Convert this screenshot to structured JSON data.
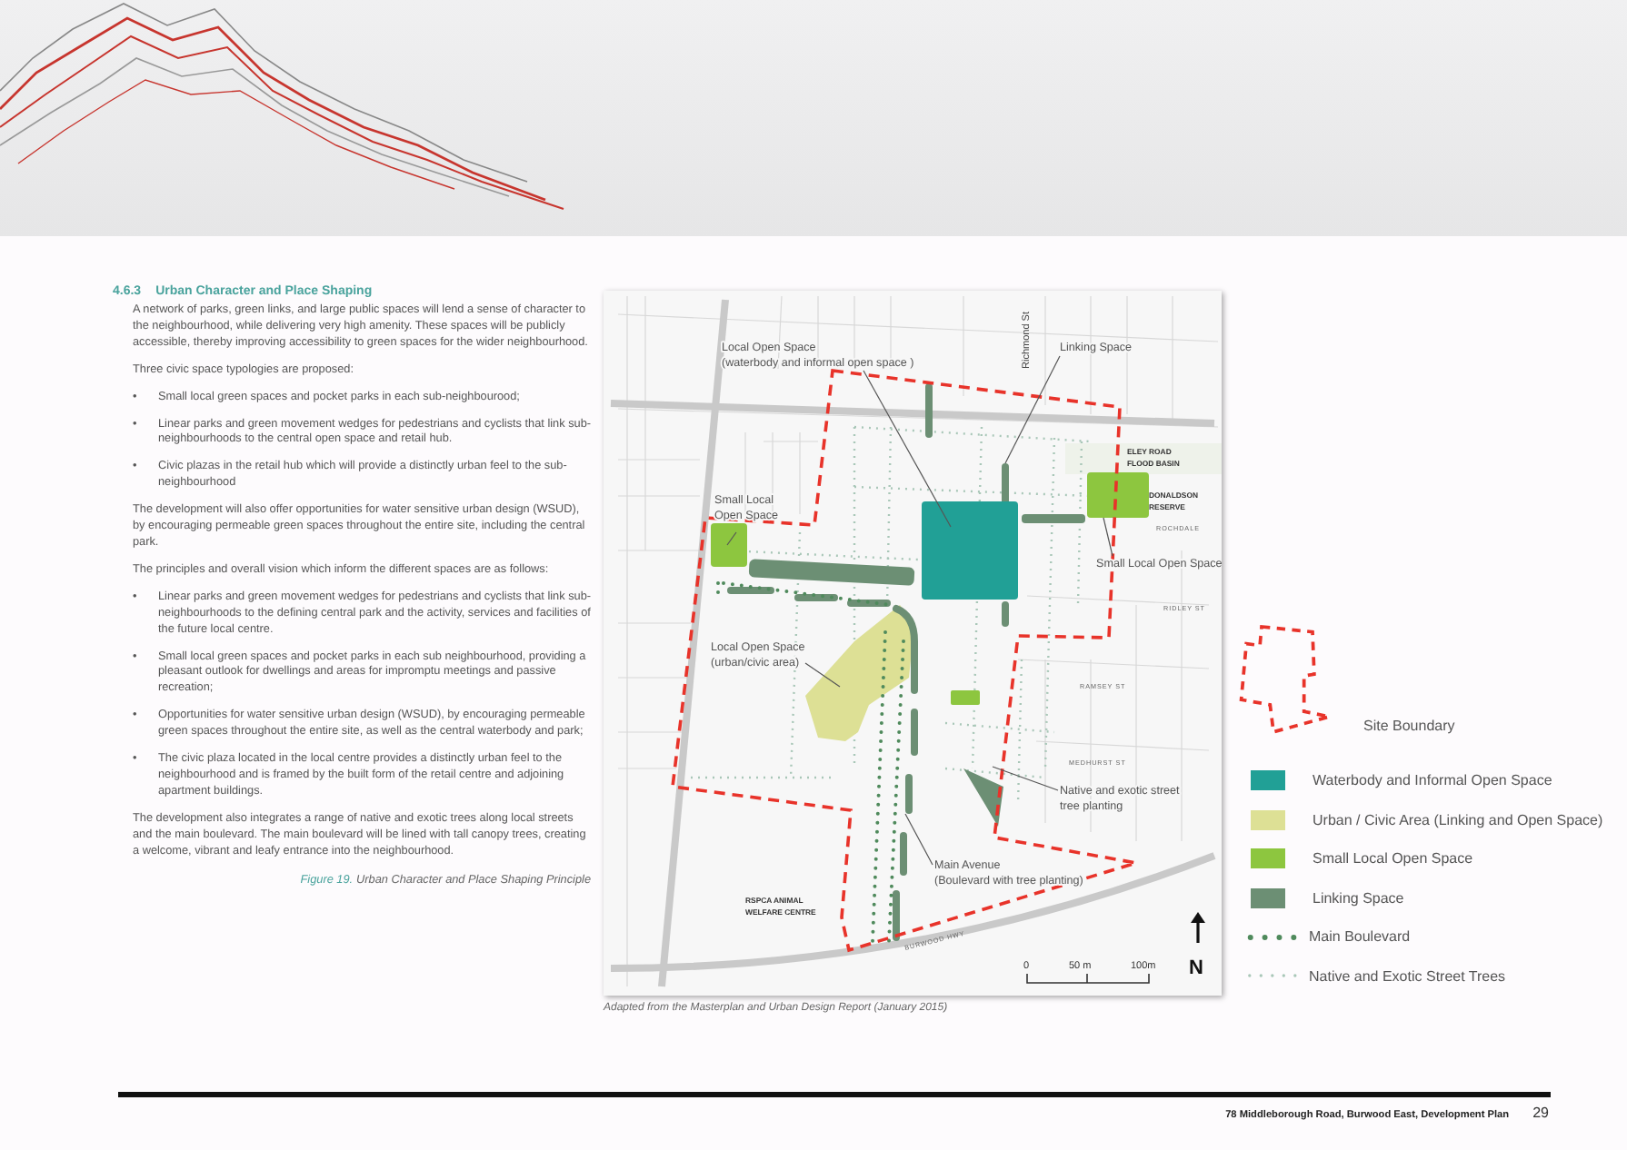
{
  "section": {
    "number": "4.6.3",
    "title": "Urban Character and Place Shaping"
  },
  "body": [
    {
      "kind": "paragraph",
      "text": "A network of parks, green links, and large public spaces will lend a sense of character to the neighbourhood, while delivering very high amenity. These spaces will be publicly accessible, thereby improving accessibility to green spaces for the wider neighbourhood."
    },
    {
      "kind": "paragraph",
      "text": "Three civic space typologies are proposed:"
    },
    {
      "kind": "bullet",
      "marker": "•",
      "text": "Small local green spaces and pocket parks in each sub-neighbourood;"
    },
    {
      "kind": "bullet",
      "marker": "•",
      "text": "Linear parks and green movement wedges for pedestrians and cyclists that link sub-neighbourhoods to the central open space and retail hub."
    },
    {
      "kind": "bullet",
      "marker": "•",
      "text": "Civic plazas in the retail hub which will provide a distinctly urban feel to the sub-neighbourhood"
    },
    {
      "kind": "paragraph",
      "text": "The development will also offer opportunities for water sensitive urban design (WSUD), by encouraging permeable green spaces throughout the entire site, including the central park."
    },
    {
      "kind": "paragraph",
      "text": "The principles and overall vision which inform the different spaces are as follows:"
    },
    {
      "kind": "bullet",
      "marker": "•",
      "text": "Linear parks and green movement wedges for pedestrians and cyclists that link sub-neighbourhoods to the defining central park and the activity, services and facilities of the future local centre."
    },
    {
      "kind": "bullet",
      "marker": "•",
      "text": "Small local green spaces and pocket parks in each sub neighbourhood, providing a pleasant outlook for dwellings and areas for impromptu meetings and passive recreation;"
    },
    {
      "kind": "bullet",
      "marker": "•",
      "text": "Opportunities for water sensitive urban design (WSUD), by encouraging permeable green spaces throughout the entire site, as well as the central waterbody and park;"
    },
    {
      "kind": "bullet",
      "marker": "•",
      "text": "The civic plaza located in the local centre provides a distinctly urban feel to the neighbourhood and is framed by the built form of the retail centre and adjoining apartment buildings."
    },
    {
      "kind": "paragraph",
      "text": "The development also integrates a range of native and exotic trees along local streets and the main boulevard. The main boulevard will be lined with tall canopy trees, creating a welcome, vibrant and leafy entrance into the neighbourhood."
    }
  ],
  "figure_caption": {
    "label": "Figure 19.",
    "text": "Urban Character and Place Shaping Principle"
  },
  "map": {
    "callouts": [
      {
        "lines": [
          "Local Open Space",
          "(waterbody and informal open space )"
        ]
      },
      {
        "lines": [
          "Linking Space"
        ]
      },
      {
        "lines": [
          "Small Local",
          "Open Space"
        ]
      },
      {
        "lines": [
          "Small Local Open Space"
        ]
      },
      {
        "lines": [
          "Local Open Space",
          "(urban/civic area)"
        ]
      },
      {
        "lines": [
          "Native and exotic street",
          "tree planting"
        ]
      },
      {
        "lines": [
          "Main Avenue",
          "(Boulevard with tree planting)"
        ]
      }
    ],
    "places": [
      {
        "lines": [
          "ELEY ROAD",
          "FLOOD BASIN"
        ]
      },
      {
        "lines": [
          "DONALDSON",
          "RESERVE"
        ]
      },
      {
        "lines": [
          "RSPCA ANIMAL",
          "WELFARE CENTRE"
        ]
      }
    ],
    "streets": [
      "Richmond St",
      "RIDLEY ST",
      "RAMSEY ST",
      "MEDHURST ST",
      "ROCHDALE",
      "BURWOOD HWY"
    ],
    "scale": [
      "0",
      "50 m",
      "100m"
    ],
    "north": "N",
    "source": "Adapted from the Masterplan and Urban Design Report (January 2015)"
  },
  "legend": [
    {
      "kind": "boundary",
      "label": "Site Boundary",
      "color": "#e8332a"
    },
    {
      "kind": "swatch",
      "label": "Waterbody and Informal Open Space",
      "color": "#21a096"
    },
    {
      "kind": "swatch",
      "label": "Urban / Civic Area (Linking and Open Space)",
      "color": "#dde095"
    },
    {
      "kind": "swatch",
      "label": "Small Local Open Space",
      "color": "#8dc63f"
    },
    {
      "kind": "swatch",
      "label": "Linking Space",
      "color": "#6c8f74"
    },
    {
      "kind": "dots",
      "label": "Main Boulevard",
      "color": "#4f8a5c"
    },
    {
      "kind": "smalldots",
      "label": "Native and Exotic Street Trees",
      "color": "#a9c7b8"
    }
  ],
  "footer": {
    "title": "78 Middleborough Road, Burwood East, Development Plan",
    "page": "29"
  }
}
